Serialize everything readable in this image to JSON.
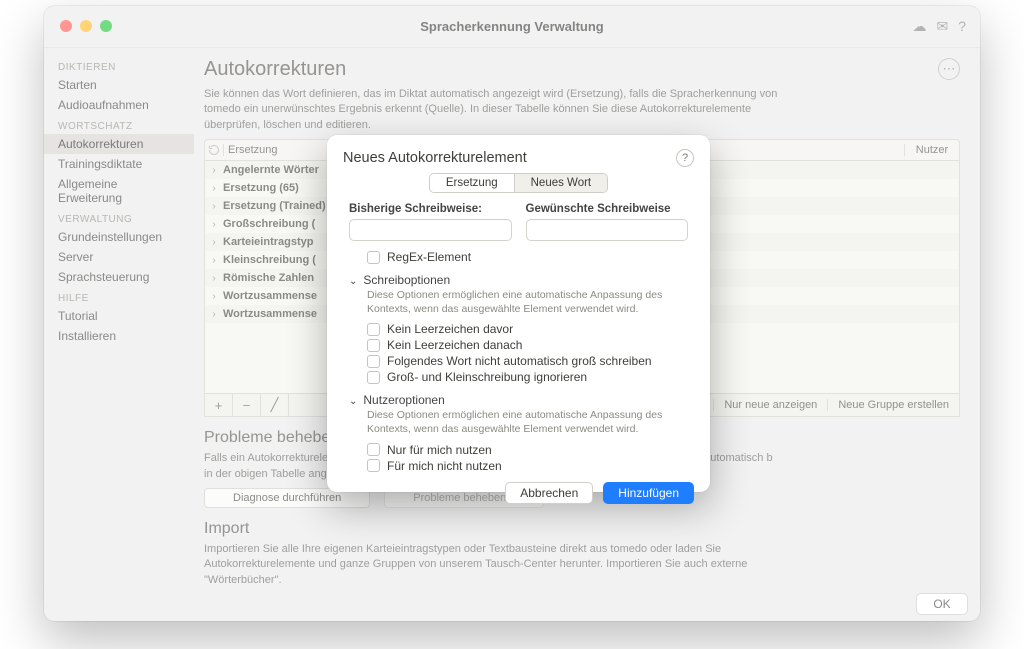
{
  "window": {
    "title": "Spracherkennung Verwaltung"
  },
  "sidebar": {
    "sections": [
      {
        "label": "DIKTIEREN",
        "items": [
          "Starten",
          "Audioaufnahmen"
        ]
      },
      {
        "label": "WORTSCHATZ",
        "items": [
          "Autokorrekturen",
          "Trainingsdiktate",
          "Allgemeine Erweiterung"
        ],
        "selected": 0
      },
      {
        "label": "VERWALTUNG",
        "items": [
          "Grundeinstellungen",
          "Server",
          "Sprachsteuerung"
        ]
      },
      {
        "label": "HILFE",
        "items": [
          "Tutorial",
          "Installieren"
        ]
      }
    ]
  },
  "main": {
    "heading": "Autokorrekturen",
    "desc": "Sie können das Wort definieren, das im Diktat automatisch angezeigt wird (Ersetzung), falls die Spracherkennung von tomedo ein unerwünschtes Ergebnis erkennt (Quelle). In dieser Tabelle können Sie diese Autokorrekturelemente überprüfen, löschen und editieren.",
    "table": {
      "col2": "Ersetzung",
      "col3": "Nutzer",
      "rows": [
        "Angelernte Wörter",
        "Ersetzung (65)",
        "Ersetzung (Trained)",
        "Großschreibung (",
        "Karteieintragstyp",
        "Kleinschreibung (",
        "Römische Zahlen",
        "Wortzusammense",
        "Wortzusammense"
      ],
      "footer": {
        "add": "+",
        "remove": "−",
        "edit": "╱",
        "right1": "Nur neue anzeigen",
        "right2": "Neue Gruppe erstellen"
      }
    },
    "problems": {
      "heading": "Probleme beheben",
      "desc1": "Falls ein Autokorrekturelement",
      "desc2": "können Sie diese Probleme automatisch b",
      "desc3": "in der obigen Tabelle angezeigt.",
      "btn1": "Diagnose durchführen",
      "btn2": "Probleme beheben..."
    },
    "import": {
      "heading": "Import",
      "desc": "Importieren Sie alle Ihre eigenen Karteieintragstypen oder Textbausteine direkt aus tomedo oder laden Sie Autokorrekturelemente und ganze Gruppen von unserem Tausch-Center herunter. Importieren Sie auch externe \"Wörterbücher\"."
    },
    "ok": "OK"
  },
  "dialog": {
    "title": "Neues Autokorrekturelement",
    "help": "?",
    "tabs": {
      "ersetzung": "Ersetzung",
      "neues": "Neues Wort"
    },
    "field1": "Bisherige Schreibweise:",
    "field2": "Gewünschte Schreibweise",
    "regex": "RegEx-Element",
    "write": {
      "head": "Schreiboptionen",
      "hint": "Diese Optionen ermöglichen eine automatische Anpassung des Kontexts, wenn das ausgewählte Element verwendet wird.",
      "o1": "Kein Leerzeichen davor",
      "o2": "Kein Leerzeichen danach",
      "o3": "Folgendes Wort nicht automatisch groß schreiben",
      "o4": "Groß- und Kleinschreibung ignorieren"
    },
    "user": {
      "head": "Nutzeroptionen",
      "hint": "Diese Optionen ermöglichen eine automatische Anpassung des Kontexts, wenn das ausgewählte Element verwendet wird.",
      "o1": "Nur für mich nutzen",
      "o2": "Für mich nicht nutzen"
    },
    "cancel": "Abbrechen",
    "add": "Hinzufügen"
  }
}
